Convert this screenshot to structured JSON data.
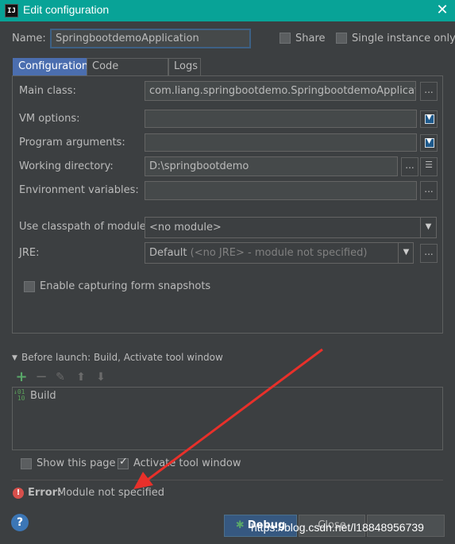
{
  "window": {
    "title": "Edit configuration",
    "app_icon_text": "IJ"
  },
  "name_row": {
    "label": "Name:",
    "value": "SpringbootdemoApplication",
    "share_label": "Share",
    "single_instance_label": "Single instance only",
    "share_checked": false,
    "single_instance_checked": false
  },
  "tabs": [
    {
      "label": "Configuration",
      "active": true
    },
    {
      "label": "Code Coverage",
      "active": false
    },
    {
      "label": "Logs",
      "active": false
    }
  ],
  "config": {
    "main_class_label": "Main class:",
    "main_class_value": "com.liang.springbootdemo.SpringbootdemoApplication",
    "vm_options_label": "VM options:",
    "vm_options_value": "",
    "program_args_label": "Program arguments:",
    "program_args_value": "",
    "working_dir_label": "Working directory:",
    "working_dir_value": "D:\\springbootdemo",
    "env_vars_label": "Environment variables:",
    "env_vars_value": "",
    "classpath_label": "Use classpath of module:",
    "classpath_value": "<no module>",
    "jre_label": "JRE:",
    "jre_value": "Default",
    "jre_hint": "(<no JRE> - module not specified)",
    "snapshots_label": "Enable capturing form snapshots",
    "snapshots_checked": false,
    "browse_label": "..."
  },
  "before_launch": {
    "header": "Before launch: Build, Activate tool window",
    "items": [
      {
        "label": "Build",
        "icon": "build-icon"
      }
    ]
  },
  "options": {
    "show_page_label": "Show this page",
    "show_page_checked": false,
    "activate_tool_label": "Activate tool window",
    "activate_tool_checked": true
  },
  "error": {
    "prefix": "Error:",
    "message": "Module not specified"
  },
  "buttons": {
    "debug_label": "Debug",
    "close_label": "Close"
  },
  "watermark": "https://blog.csdn.net/l18848956739",
  "colors": {
    "title_bar": "#08a397",
    "background": "#3c3f41",
    "active_tab": "#4b6eaf",
    "error": "#d7504c",
    "arrow": "#e8302a",
    "add_icon": "#59a869"
  }
}
